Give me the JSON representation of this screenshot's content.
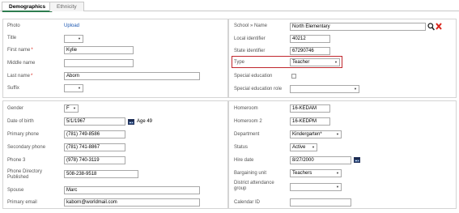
{
  "tabs": [
    {
      "label": "Demographics",
      "active": true
    },
    {
      "label": "Ethnicity",
      "active": false
    }
  ],
  "left_top": {
    "photo_label": "Photo",
    "upload_link": "Upload",
    "title_label": "Title",
    "title_value": "",
    "first_name_label": "First name",
    "first_name_value": "Kylie",
    "middle_name_label": "Middle name",
    "middle_name_value": "",
    "last_name_label": "Last name",
    "last_name_value": "Aborn",
    "suffix_label": "Suffix",
    "suffix_value": ""
  },
  "right_top": {
    "school_label": "School » Name",
    "school_value": "North Elementary",
    "local_id_label": "Local identifier",
    "local_id_value": "40212",
    "state_id_label": "State identifier",
    "state_id_value": "67290746",
    "type_label": "Type",
    "type_value": "Teacher",
    "sped_label": "Special education",
    "sped_role_label": "Special education role",
    "sped_role_value": ""
  },
  "left_bottom": {
    "gender_label": "Gender",
    "gender_value": "F",
    "dob_label": "Date of birth",
    "dob_value": "5/1/1967",
    "age_text": "Age 49",
    "primary_phone_label": "Primary phone",
    "primary_phone_value": "(781) 749-8586",
    "secondary_phone_label": "Secondary phone",
    "secondary_phone_value": "(781) 741-8867",
    "phone3_label": "Phone 3",
    "phone3_value": "(978) 740-3119",
    "phone_dir_label": "Phone Directory Published",
    "phone_dir_value": "508-238-9518",
    "spouse_label": "Spouse",
    "spouse_value": "Marc",
    "email_label": "Primary email",
    "email_value": "kaborn@worldmail.com"
  },
  "right_bottom": {
    "homeroom_label": "Homeroom",
    "homeroom_value": "16-KEDAM",
    "homeroom2_label": "Homeroom 2",
    "homeroom2_value": "16-KEDPM",
    "department_label": "Department",
    "department_value": "Kindergarten*",
    "status_label": "Status",
    "status_value": "Active",
    "hire_date_label": "Hire date",
    "hire_date_value": "8/27/2000",
    "bargaining_label": "Bargaining unit",
    "bargaining_value": "Teachers",
    "district_label": "District attendance group",
    "district_value": "",
    "calendar_label": "Calendar ID",
    "calendar_value": ""
  },
  "colors": {
    "required": "#d9241b",
    "link": "#1a56b0",
    "highlight": "#c0272d",
    "active_tab_underline": "#2e7d4f"
  }
}
